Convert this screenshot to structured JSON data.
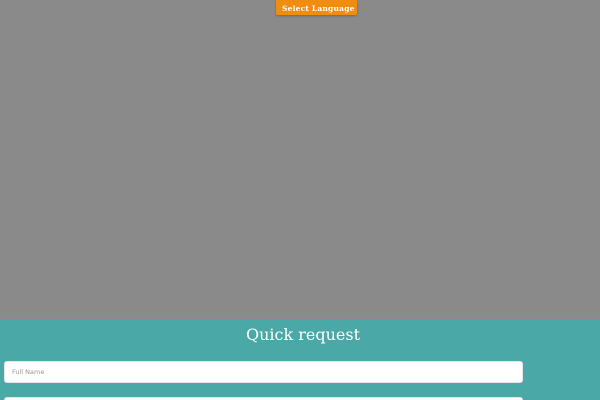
{
  "header": {
    "language_button_label": "Select Language"
  },
  "quick_request": {
    "title": "Quick request",
    "full_name": {
      "value": "",
      "placeholder": "Full Name"
    },
    "second_field": {
      "value": "",
      "placeholder": ""
    }
  },
  "colors": {
    "hero_background": "#8a8a8a",
    "accent_orange": "#f08c0f",
    "section_teal": "#4aa9a7",
    "field_background": "#ffffff"
  }
}
